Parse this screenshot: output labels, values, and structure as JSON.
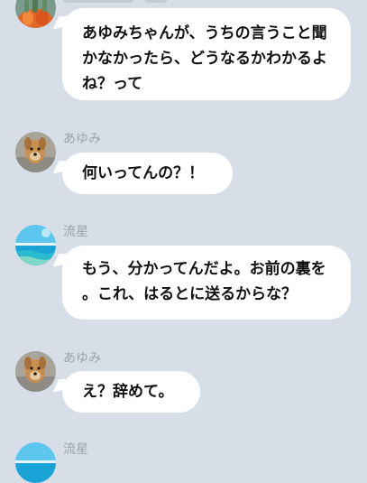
{
  "messages": [
    {
      "id": "m1",
      "sender": "",
      "avatar": "orange-cactus-avatar",
      "lines": [
        "あゆみちゃんが、うちの言うこと聞",
        "かなかったら、どうなるかわかるよ",
        "ね？って"
      ]
    },
    {
      "id": "m2",
      "sender": "あゆみ",
      "avatar": "dog-avatar",
      "lines": [
        "何いってんの？！"
      ]
    },
    {
      "id": "m3",
      "sender": "流星",
      "avatar": "ocean-avatar",
      "lines": [
        "もう、分かってんだよ。お前の裏を",
        "。これ、はるとに送るからな？"
      ]
    },
    {
      "id": "m4",
      "sender": "あゆみ",
      "avatar": "dog-avatar",
      "lines": [
        "え？辞めて。"
      ]
    },
    {
      "id": "m5",
      "sender": "流星",
      "avatar": "ocean-avatar",
      "lines": []
    }
  ],
  "colors": {
    "background": "#d7dee8",
    "bubble": "#ffffff",
    "sender_name": "#9aa3ad",
    "text": "#111111"
  }
}
